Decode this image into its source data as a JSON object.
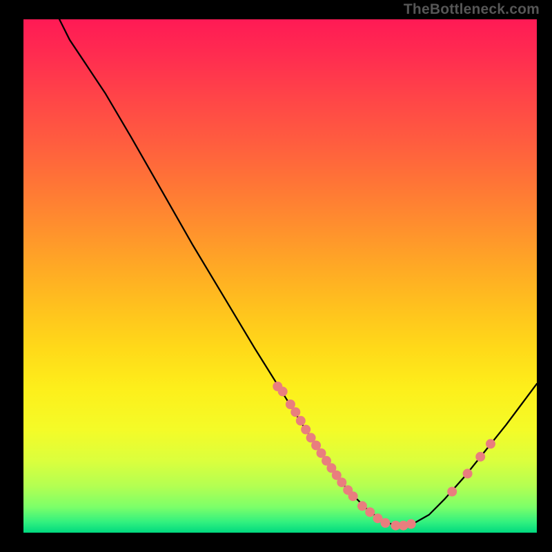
{
  "watermark": "TheBottleneck.com",
  "chart_data": {
    "type": "line",
    "title": "",
    "xlabel": "",
    "ylabel": "",
    "x_visible_range": [
      0,
      100
    ],
    "y_visible_range": [
      0,
      100
    ],
    "grid": false,
    "legend": false,
    "curve_note": "V-shaped bottleneck curve. Descends from top-left, reaches minimum around x≈73 near the bottom, rises toward the right edge. Axes have no visible tick labels.",
    "curve": [
      {
        "x": 7.0,
        "y": 100.0
      },
      {
        "x": 9.0,
        "y": 96.0
      },
      {
        "x": 12.0,
        "y": 91.5
      },
      {
        "x": 16.0,
        "y": 85.5
      },
      {
        "x": 21.0,
        "y": 77.0
      },
      {
        "x": 27.0,
        "y": 66.5
      },
      {
        "x": 33.0,
        "y": 56.0
      },
      {
        "x": 39.0,
        "y": 46.0
      },
      {
        "x": 45.0,
        "y": 36.0
      },
      {
        "x": 50.0,
        "y": 28.0
      },
      {
        "x": 55.0,
        "y": 20.0
      },
      {
        "x": 59.0,
        "y": 14.0
      },
      {
        "x": 63.0,
        "y": 8.5
      },
      {
        "x": 67.0,
        "y": 4.5
      },
      {
        "x": 70.0,
        "y": 2.2
      },
      {
        "x": 73.0,
        "y": 1.3
      },
      {
        "x": 76.0,
        "y": 1.8
      },
      {
        "x": 79.0,
        "y": 3.5
      },
      {
        "x": 82.0,
        "y": 6.5
      },
      {
        "x": 86.0,
        "y": 11.0
      },
      {
        "x": 90.0,
        "y": 16.0
      },
      {
        "x": 94.0,
        "y": 21.0
      },
      {
        "x": 97.0,
        "y": 25.0
      },
      {
        "x": 100.0,
        "y": 29.0
      }
    ],
    "markers": [
      {
        "x": 49.5,
        "y": 28.5
      },
      {
        "x": 50.5,
        "y": 27.5
      },
      {
        "x": 52.0,
        "y": 25.0
      },
      {
        "x": 53.0,
        "y": 23.5
      },
      {
        "x": 54.0,
        "y": 21.8
      },
      {
        "x": 55.0,
        "y": 20.1
      },
      {
        "x": 56.0,
        "y": 18.5
      },
      {
        "x": 57.0,
        "y": 17.0
      },
      {
        "x": 58.0,
        "y": 15.5
      },
      {
        "x": 59.0,
        "y": 14.0
      },
      {
        "x": 60.0,
        "y": 12.6
      },
      {
        "x": 61.0,
        "y": 11.2
      },
      {
        "x": 62.0,
        "y": 9.8
      },
      {
        "x": 63.2,
        "y": 8.3
      },
      {
        "x": 64.2,
        "y": 7.1
      },
      {
        "x": 66.0,
        "y": 5.2
      },
      {
        "x": 67.5,
        "y": 4.0
      },
      {
        "x": 69.0,
        "y": 2.8
      },
      {
        "x": 70.5,
        "y": 1.9
      },
      {
        "x": 72.5,
        "y": 1.4
      },
      {
        "x": 74.0,
        "y": 1.4
      },
      {
        "x": 75.5,
        "y": 1.7
      },
      {
        "x": 83.5,
        "y": 8.0
      },
      {
        "x": 86.5,
        "y": 11.5
      },
      {
        "x": 89.0,
        "y": 14.8
      },
      {
        "x": 91.0,
        "y": 17.3
      }
    ],
    "marker_style": {
      "color": "#e97e7e",
      "radius_px": 7
    }
  }
}
